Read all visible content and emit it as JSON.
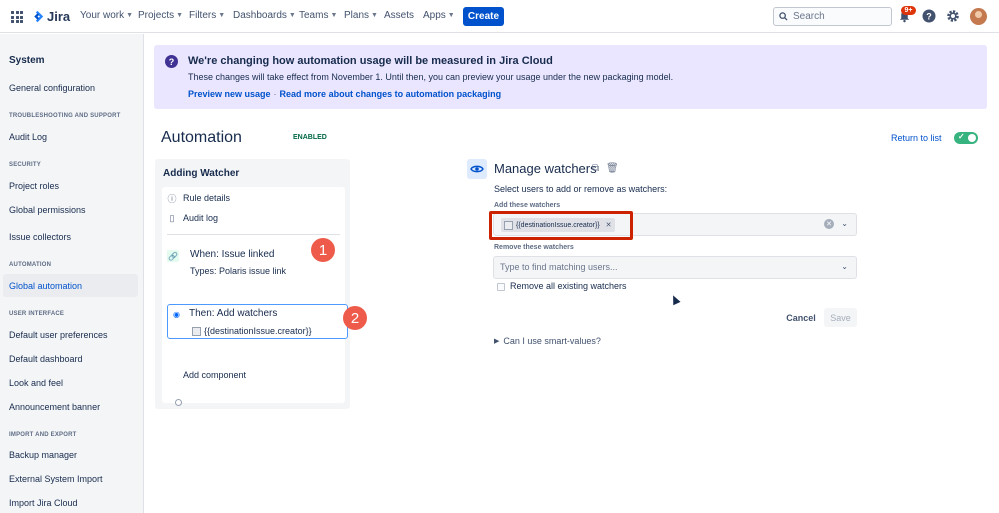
{
  "topnav": {
    "logo": "Jira",
    "items": [
      {
        "label": "Your work",
        "chevron": true
      },
      {
        "label": "Projects",
        "chevron": true
      },
      {
        "label": "Filters",
        "chevron": true
      },
      {
        "label": "Dashboards",
        "chevron": true
      },
      {
        "label": "Teams",
        "chevron": true
      },
      {
        "label": "Plans",
        "chevron": true
      },
      {
        "label": "Assets",
        "chevron": false
      },
      {
        "label": "Apps",
        "chevron": true
      }
    ],
    "create_label": "Create",
    "search_placeholder": "Search",
    "notification_count": "9+",
    "icons": [
      "app-switcher-icon",
      "jira-logo",
      "search-icon",
      "bell-icon",
      "help-icon",
      "gear-icon",
      "avatar"
    ]
  },
  "sidebar": {
    "title": "System",
    "general": "General configuration",
    "troubleshooting_head": "TROUBLESHOOTING AND SUPPORT",
    "audit_log": "Audit Log",
    "security_head": "SECURITY",
    "project_roles": "Project roles",
    "global_permissions": "Global permissions",
    "issue_collectors": "Issue collectors",
    "automation_head": "AUTOMATION",
    "global_automation": "Global automation",
    "ui_head": "USER INTERFACE",
    "default_user_prefs": "Default user preferences",
    "default_dashboard": "Default dashboard",
    "look_and_feel": "Look and feel",
    "announcement_banner": "Announcement banner",
    "import_head": "IMPORT AND EXPORT",
    "backup_manager": "Backup manager",
    "external_import": "External System Import",
    "import_jira_cloud": "Import Jira Cloud"
  },
  "banner": {
    "title": "We're changing how automation usage will be measured in Jira Cloud",
    "text": "These changes will take effect from November 1. Until then, you can preview your usage under the new packaging model.",
    "link1": "Preview new usage",
    "separator": "·",
    "link2": "Read more about changes to automation packaging",
    "accent": "#eae6ff"
  },
  "page": {
    "title": "Automation",
    "status": "ENABLED",
    "return_link": "Return to list",
    "toggle_on": true
  },
  "rule": {
    "name": "Adding Watcher",
    "details": "Rule details",
    "audit": "Audit log",
    "trigger_title": "When: Issue linked",
    "trigger_sub": "Types: Polaris issue link",
    "action_title": "Then: Add watchers",
    "action_sub": "{{destinationIssue.creator}}",
    "add_component": "Add component"
  },
  "markers": {
    "one": "1",
    "two": "2"
  },
  "config": {
    "title": "Manage watchers",
    "description": "Select users to add or remove as watchers:",
    "add_label": "Add these watchers",
    "add_chip": "{{destinationIssue.creator}}",
    "remove_label": "Remove these watchers",
    "remove_placeholder": "Type to find matching users...",
    "remove_all": "Remove all existing watchers",
    "cancel": "Cancel",
    "save": "Save",
    "smart_values": "Can I use smart-values?"
  }
}
